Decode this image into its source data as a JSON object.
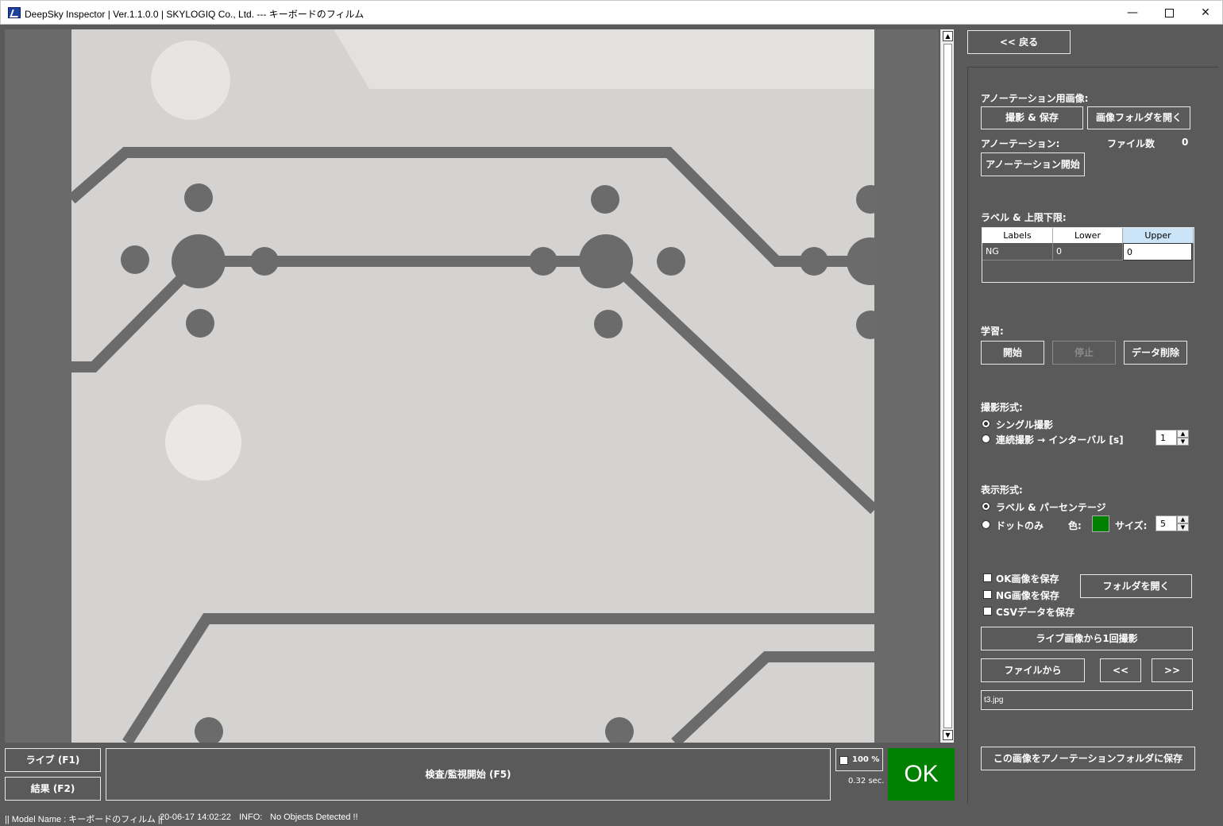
{
  "window": {
    "title": "DeepSky Inspector | Ver.1.1.0.0 | SKYLOGIQ Co., Ltd. --- キーボードのフィルム",
    "minimize": "—",
    "close": "✕"
  },
  "viewer": {
    "scroll_up": "▲",
    "scroll_down": "▼"
  },
  "bottom": {
    "live_label": "ライブ (F1)",
    "result_label": "結果 (F2)",
    "inspect_label": "検査/監視開始 (F5)",
    "zoom_label": "100 %",
    "time_label": "0.32 sec.",
    "judge_label": "OK",
    "judge_color": "#008000"
  },
  "status": {
    "model": "|| Model Name : キーボードのフィルム ||",
    "timestamp": "20-06-17 14:02:22",
    "info_label": "INFO:",
    "info_text": "No Objects Detected !!"
  },
  "panel": {
    "back_label": "<< 戻る",
    "annotation_image_heading": "アノーテーション用画像:",
    "capture_save_label": "撮影 & 保存",
    "open_image_folder_label": "画像フォルダを開く",
    "annotation_heading": "アノーテーション:",
    "file_count_label": "ファイル数",
    "file_count_value": "0",
    "start_annotation_label": "アノーテーション開始",
    "label_limits_heading": "ラベル & 上限下限:",
    "grid": {
      "headers": [
        "Labels",
        "Lower",
        "Upper"
      ],
      "rows": [
        [
          "NG",
          "0",
          "0"
        ]
      ]
    },
    "learning_heading": "学習:",
    "start_label": "開始",
    "stop_label": "停止",
    "delete_data_label": "データ削除",
    "capture_mode_heading": "撮影形式:",
    "single_capture_label": "シングル撮影",
    "continuous_capture_label": "連続撮影 → インターバル [s]",
    "interval_value": "1",
    "display_mode_heading": "表示形式:",
    "label_percentage_label": "ラベル & パーセンテージ",
    "dot_only_label": "ドットのみ",
    "color_label": "色:",
    "dot_color": "#008000",
    "size_label": "サイズ:",
    "size_value": "5",
    "save_ok_label": "OK画像を保存",
    "save_ng_label": "NG画像を保存",
    "save_csv_label": "CSVデータを保存",
    "open_folder_label": "フォルダを開く",
    "capture_once_label": "ライブ画像から1回撮影",
    "from_file_label": "ファイルから",
    "prev_label": "<<",
    "next_label": ">>",
    "file_name": "t3.jpg",
    "save_to_annotation_label": "この画像をアノーテーションフォルダに保存"
  }
}
